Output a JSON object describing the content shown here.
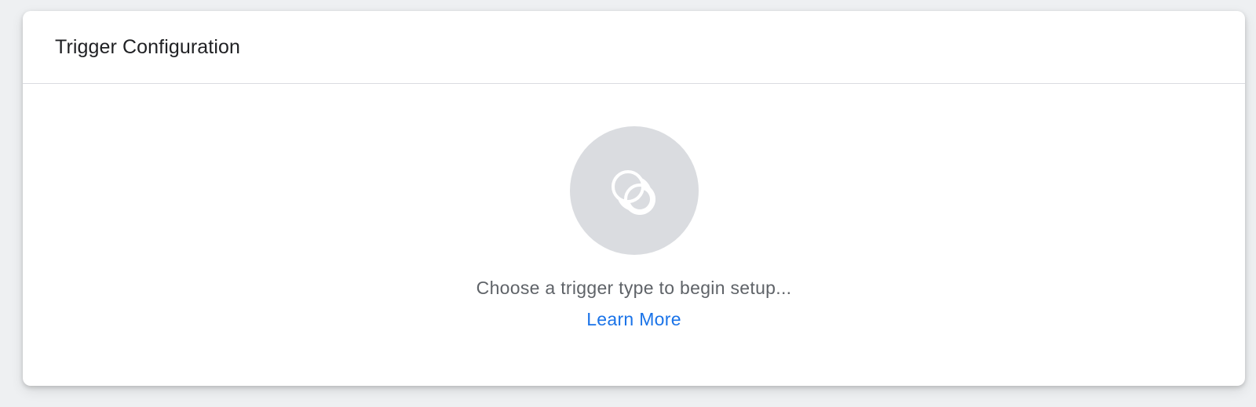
{
  "panel": {
    "title": "Trigger Configuration",
    "prompt": "Choose a trigger type to begin setup...",
    "learn_more_label": "Learn More",
    "placeholder_icon": "trigger-icon"
  },
  "colors": {
    "accent_link": "#1a73e8",
    "icon_background": "#dadce0",
    "muted_text": "#5f6368",
    "title_text": "#202124"
  }
}
